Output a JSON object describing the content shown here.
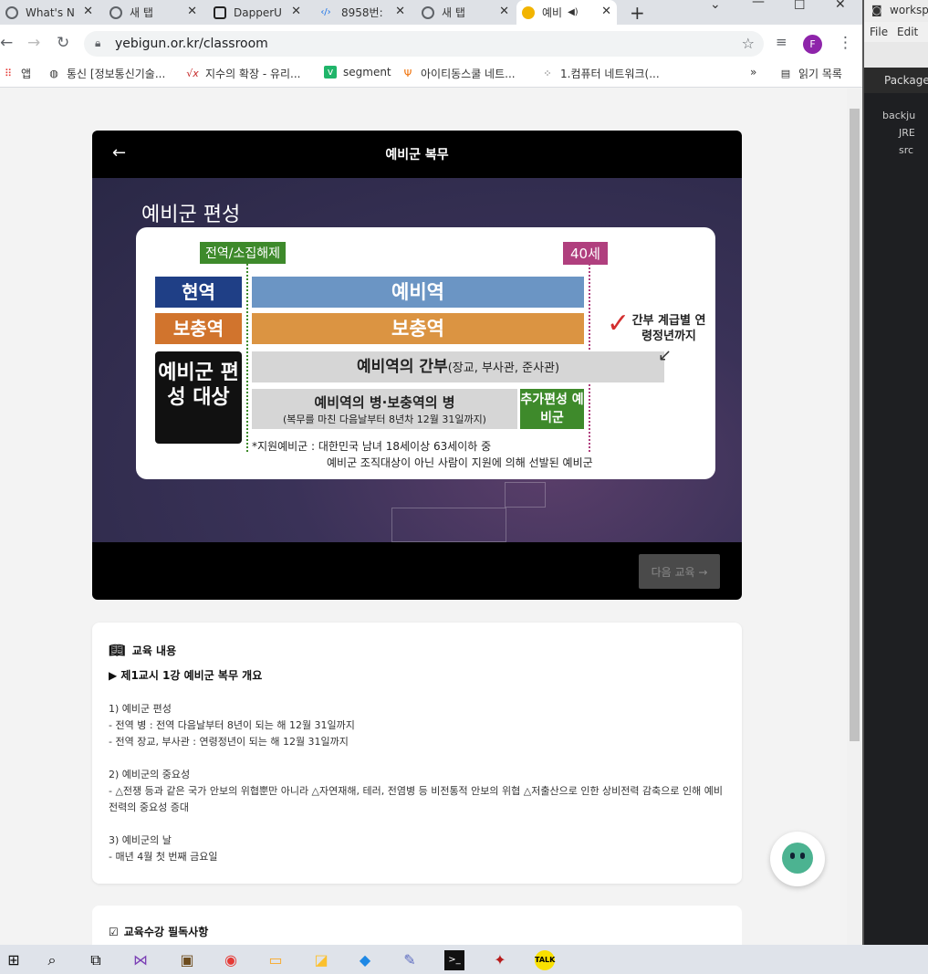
{
  "browser": {
    "tabs": [
      {
        "label": "What's N",
        "color": "#5f6368"
      },
      {
        "label": "새 탭",
        "color": "#5f6368"
      },
      {
        "label": "DapperU",
        "color": "#222"
      },
      {
        "label": "8958번: ",
        "color": "#1a73e8"
      },
      {
        "label": "새 탭",
        "color": "#5f6368"
      },
      {
        "label": "예비",
        "color": "#f2b400"
      }
    ],
    "new_tab": "+",
    "url": "yebigun.or.kr/classroom",
    "profile_initial": "F",
    "bookmarks": [
      {
        "label": "앱"
      },
      {
        "label": "통신 [정보통신기술..."
      },
      {
        "label": "지수의 확장 - 유리..."
      },
      {
        "label": "segment"
      },
      {
        "label": "아이티동스쿨 네트..."
      },
      {
        "label": "1.컴퓨터 네트워크(..."
      }
    ],
    "bookmarks_more": "»",
    "reading_list": "읽기 목록"
  },
  "player": {
    "title": "예비군 복무",
    "back_icon": "←",
    "next_button": "다음 교육 →",
    "slide": {
      "title": "예비군 편성",
      "tag_discharge": "전역/소집해제",
      "tag_age": "40세",
      "active": "현역",
      "reserve": "예비역",
      "supplement": "보충역",
      "supplement_bar": "보충역",
      "target": "예비군 편성 대상",
      "officer_bar_main": "예비역의 간부",
      "officer_bar_sub": "(장교, 부사관, 준사관)",
      "soldier_bar_main": "예비역의 병·보충역의 병",
      "soldier_bar_sub": "(복무를 마친 다음날부터 8년차 12월 31일까지)",
      "extra": "추가편성 예비군",
      "note_officer": "간부 계급별 연령정년까지",
      "volunteer_line1": "*지원예비군 : 대한민국 남녀 18세이상 63세이하 중",
      "volunteer_line2": "예비군 조직대상이 아닌 사람이 지원에 의해 선발된 예비군"
    }
  },
  "content": {
    "header": "교육 내용",
    "lesson": "▶ 제1교시 1강 예비군 복무 개요",
    "lines": [
      "1) 예비군 편성",
      "- 전역 병 : 전역 다음날부터 8년이 되는 해 12월 31일까지",
      "- 전역 장교, 부사관 : 연령정년이 되는 해 12월 31일까지",
      "",
      "2) 예비군의 중요성",
      "- △전쟁 등과 같은 국가 안보의 위협뿐만 아니라 △자연재해, 테러, 전염병 등 비전통적 안보의 위협 △저출산으로 인한 상비전력 감축으로 인해 예비전력의 중요성 증대",
      "",
      "3) 예비군의 날",
      "- 매년 4월 첫 번째 금요일"
    ]
  },
  "notice": {
    "header": "교육수강 필독사항"
  },
  "eclipse": {
    "title": "workspa",
    "menu_file": "File",
    "menu_edit": "Edit",
    "package": "Package",
    "tree": [
      "backju",
      "JRE",
      "src"
    ]
  }
}
